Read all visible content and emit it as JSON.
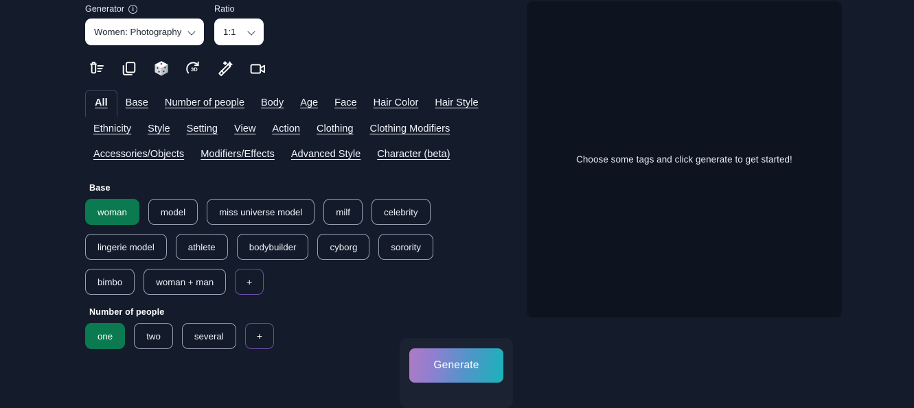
{
  "controls": {
    "generator": {
      "label": "Generator",
      "info_icon": "info-circle-icon",
      "value": "Women: Photography",
      "chevron_icon": "chevron-down-icon"
    },
    "ratio": {
      "label": "Ratio",
      "value": "1:1",
      "chevron_icon": "chevron-down-icon"
    }
  },
  "toolbar": {
    "icons": [
      {
        "name": "clear-list-icon",
        "title": "Clear"
      },
      {
        "name": "copy-icon",
        "title": "Duplicate"
      },
      {
        "name": "dice-icon",
        "title": "Randomize"
      },
      {
        "name": "rotate-3d-icon",
        "title": "3D"
      },
      {
        "name": "magic-wand-icon",
        "title": "Enhance"
      },
      {
        "name": "video-camera-icon",
        "title": "Video"
      }
    ]
  },
  "tabs": {
    "active": "All",
    "items": [
      "All",
      "Base",
      "Number of people",
      "Body",
      "Age",
      "Face",
      "Hair Color",
      "Hair Style",
      "Ethnicity",
      "Style",
      "Setting",
      "View",
      "Action",
      "Clothing",
      "Clothing Modifiers",
      "Accessories/Objects",
      "Modifiers/Effects",
      "Advanced Style",
      "Character (beta)"
    ]
  },
  "groups": [
    {
      "title": "Base",
      "tags": [
        {
          "label": "woman",
          "selected": true
        },
        {
          "label": "model",
          "selected": false
        },
        {
          "label": "miss universe model",
          "selected": false
        },
        {
          "label": "milf",
          "selected": false
        },
        {
          "label": "celebrity",
          "selected": false
        },
        {
          "label": "lingerie model",
          "selected": false
        },
        {
          "label": "athlete",
          "selected": false
        },
        {
          "label": "bodybuilder",
          "selected": false
        },
        {
          "label": "cyborg",
          "selected": false
        },
        {
          "label": "sorority",
          "selected": false
        },
        {
          "label": "bimbo",
          "selected": false
        },
        {
          "label": "woman + man",
          "selected": false
        }
      ],
      "add_label": "+"
    },
    {
      "title": "Number of people",
      "tags": [
        {
          "label": "one",
          "selected": true
        },
        {
          "label": "two",
          "selected": false
        },
        {
          "label": "several",
          "selected": false
        }
      ],
      "add_label": "+"
    }
  ],
  "preview": {
    "empty_message": "Choose some tags and click generate to get started!"
  },
  "generate": {
    "label": "Generate"
  },
  "colors": {
    "page_background": "#141c2c",
    "preview_background": "#0d131f",
    "selected_tag": "#0b7a50",
    "add_tag_border": "#6d4fa8",
    "generate_gradient_start": "#b07ac4",
    "generate_gradient_end": "#19b3b8",
    "dock_background": "#1b2333"
  }
}
